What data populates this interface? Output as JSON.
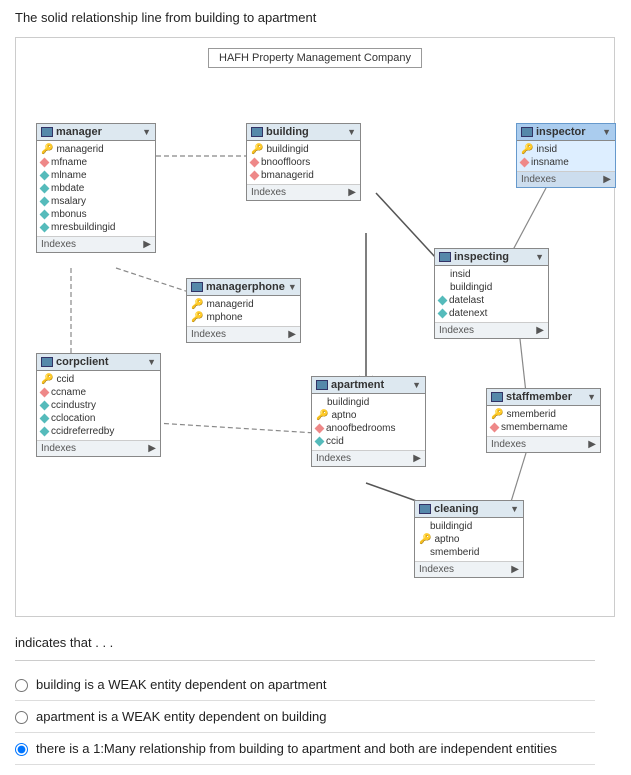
{
  "intro": {
    "text": "The solid relationship line from building to apartment"
  },
  "diagram": {
    "title": "HAFH Property Management Company",
    "entities": {
      "manager": {
        "name": "manager",
        "fields": [
          {
            "icon": "key",
            "name": "managerid"
          },
          {
            "icon": "diamond-pink",
            "name": "mfname"
          },
          {
            "icon": "diamond-teal",
            "name": "mlname"
          },
          {
            "icon": "diamond-teal",
            "name": "mbdate"
          },
          {
            "icon": "diamond-teal",
            "name": "msalary"
          },
          {
            "icon": "diamond-teal",
            "name": "mbonus"
          },
          {
            "icon": "diamond-teal",
            "name": "mresbuildingid"
          }
        ],
        "indexes": true
      },
      "building": {
        "name": "building",
        "fields": [
          {
            "icon": "key",
            "name": "buildingid"
          },
          {
            "icon": "diamond-pink",
            "name": "bnooffloors"
          },
          {
            "icon": "diamond-pink",
            "name": "bmanagerid"
          }
        ],
        "indexes": true
      },
      "inspector": {
        "name": "inspector",
        "fields": [
          {
            "icon": "key",
            "name": "insid"
          },
          {
            "icon": "diamond-pink",
            "name": "insname"
          }
        ],
        "indexes": true
      },
      "managerphone": {
        "name": "managerphone",
        "fields": [
          {
            "icon": "key",
            "name": "managerid"
          },
          {
            "icon": "key",
            "name": "mphone"
          }
        ],
        "indexes": true
      },
      "inspecting": {
        "name": "inspecting",
        "fields": [
          {
            "icon": "none",
            "name": "insid"
          },
          {
            "icon": "none",
            "name": "buildingid"
          },
          {
            "icon": "diamond-teal",
            "name": "datelast"
          },
          {
            "icon": "diamond-teal",
            "name": "datenext"
          }
        ],
        "indexes": true
      },
      "corpclient": {
        "name": "corpclient",
        "fields": [
          {
            "icon": "key",
            "name": "ccid"
          },
          {
            "icon": "diamond-pink",
            "name": "ccname"
          },
          {
            "icon": "diamond-teal",
            "name": "ccindustry"
          },
          {
            "icon": "diamond-teal",
            "name": "cclocation"
          },
          {
            "icon": "diamond-teal",
            "name": "ccidreferredby"
          }
        ],
        "indexes": true
      },
      "apartment": {
        "name": "apartment",
        "fields": [
          {
            "icon": "none",
            "name": "buildingid"
          },
          {
            "icon": "key",
            "name": "aptno"
          },
          {
            "icon": "diamond-pink",
            "name": "anoofbedrooms"
          },
          {
            "icon": "diamond-teal",
            "name": "ccid"
          }
        ],
        "indexes": true
      },
      "staffmember": {
        "name": "staffmember",
        "fields": [
          {
            "icon": "key",
            "name": "smemberid"
          },
          {
            "icon": "diamond-pink",
            "name": "smembername"
          }
        ],
        "indexes": true
      },
      "cleaning": {
        "name": "cleaning",
        "fields": [
          {
            "icon": "none",
            "name": "buildingid"
          },
          {
            "icon": "key",
            "name": "aptno"
          },
          {
            "icon": "none",
            "name": "smemberid"
          }
        ],
        "indexes": true
      }
    }
  },
  "question": {
    "label": "indicates that . . .",
    "options": [
      {
        "id": "opt1",
        "text": "building is a WEAK entity dependent on apartment",
        "selected": false
      },
      {
        "id": "opt2",
        "text": "apartment is a WEAK entity dependent on building",
        "selected": false
      },
      {
        "id": "opt3",
        "text": "there is a 1:Many relationship from building to apartment and both are independent entities",
        "selected": true
      }
    ]
  },
  "indexes_label": "Indexes",
  "dropdown_arrow": "▼"
}
